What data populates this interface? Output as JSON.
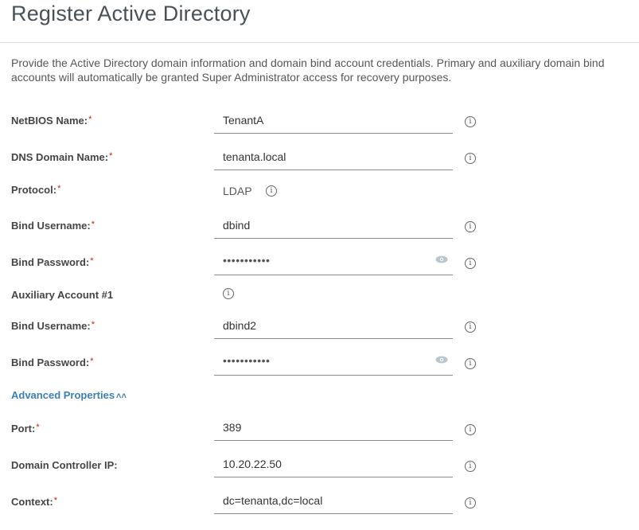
{
  "header": {
    "title": "Register Active Directory"
  },
  "description": "Provide the Active Directory domain information and domain bind account credentials. Primary and auxiliary domain bind accounts will automatically be granted Super Administrator access for recovery purposes.",
  "required_marker": "*",
  "info_glyph": "i",
  "fields": {
    "netbios": {
      "label": "NetBIOS Name:",
      "value": "TenantA"
    },
    "dns": {
      "label": "DNS Domain Name:",
      "value": "tenanta.local"
    },
    "protocol": {
      "label": "Protocol:",
      "value": "LDAP"
    },
    "bind_username": {
      "label": "Bind Username:",
      "value": "dbind"
    },
    "bind_password": {
      "label": "Bind Password:",
      "value": "•••••••••••"
    },
    "aux_heading": {
      "label": "Auxiliary Account #1"
    },
    "aux_bind_username": {
      "label": "Bind Username:",
      "value": "dbind2"
    },
    "aux_bind_password": {
      "label": "Bind Password:",
      "value": "•••••••••••"
    },
    "port": {
      "label": "Port:",
      "value": "389"
    },
    "dc_ip": {
      "label": "Domain Controller IP:",
      "value": "10.20.22.50"
    },
    "context": {
      "label": "Context:",
      "value": "dc=tenanta,dc=local"
    }
  },
  "advanced": {
    "label": "Advanced Properties",
    "chevron": "˄˄",
    "icon": "double-chevron-up-icon"
  }
}
